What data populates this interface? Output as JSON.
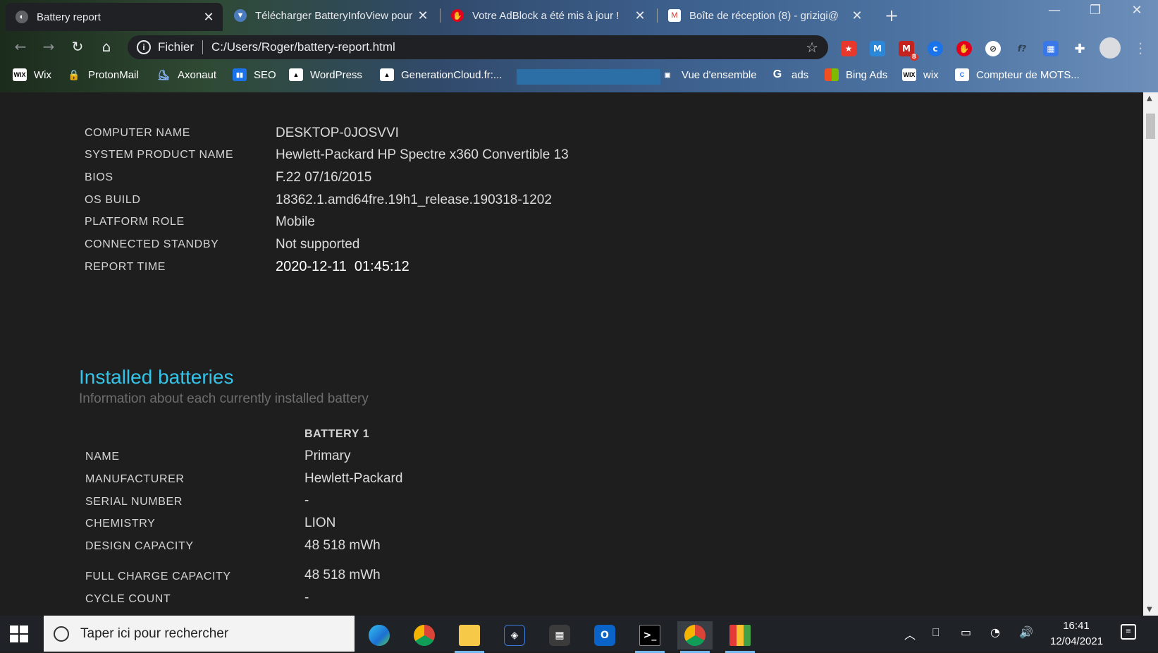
{
  "browser": {
    "tabs": [
      {
        "title": "Battery report",
        "active": true,
        "icon": "battery-report-icon"
      },
      {
        "title": "Télécharger BatteryInfoView pour",
        "active": false,
        "icon": "download-icon"
      },
      {
        "title": "Votre AdBlock a été mis à jour !",
        "active": false,
        "icon": "adblock-icon"
      },
      {
        "title": "Boîte de réception (8) - grizigi@",
        "active": false,
        "icon": "gmail-icon"
      }
    ],
    "address": {
      "scheme_label": "Fichier",
      "url": "C:/Users/Roger/battery-report.html"
    },
    "gmail_badge": "8",
    "bookmarks": [
      {
        "label": "Wix",
        "icon": "wix-icon"
      },
      {
        "label": "ProtonMail",
        "icon": "protonmail-icon"
      },
      {
        "label": "Axonaut",
        "icon": "axonaut-icon"
      },
      {
        "label": "SEO",
        "icon": "chart-icon"
      },
      {
        "label": "WordPress",
        "icon": "wordpress-icon"
      },
      {
        "label": "GenerationCloud.fr:...",
        "icon": "cloud-icon"
      },
      {
        "label": "Vue d'ensemble",
        "icon": "overview-icon"
      },
      {
        "label": "ads",
        "icon": "google-icon"
      },
      {
        "label": "Bing Ads",
        "icon": "microsoft-icon"
      },
      {
        "label": "wix",
        "icon": "wix-icon"
      },
      {
        "label": "Compteur de MOTS...",
        "icon": "counter-icon"
      }
    ]
  },
  "system_info": [
    {
      "label": "COMPUTER NAME",
      "value": "DESKTOP-0JOSVVI"
    },
    {
      "label": "SYSTEM PRODUCT NAME",
      "value": "Hewlett-Packard HP Spectre x360 Convertible 13"
    },
    {
      "label": "BIOS",
      "value": "F.22 07/16/2015"
    },
    {
      "label": "OS BUILD",
      "value": "18362.1.amd64fre.19h1_release.190318-1202"
    },
    {
      "label": "PLATFORM ROLE",
      "value": "Mobile"
    },
    {
      "label": "CONNECTED STANDBY",
      "value": "Not supported"
    },
    {
      "label": "REPORT TIME",
      "value": "2020-12-11  01:45:12"
    }
  ],
  "installed": {
    "heading": "Installed batteries",
    "subheading": "Information about each currently installed battery",
    "column": "BATTERY 1",
    "rows": [
      {
        "label": "NAME",
        "value": "Primary"
      },
      {
        "label": "MANUFACTURER",
        "value": "Hewlett-Packard"
      },
      {
        "label": "SERIAL NUMBER",
        "value": "-"
      },
      {
        "label": "CHEMISTRY",
        "value": "LION"
      },
      {
        "label": "DESIGN CAPACITY",
        "value": "48 518 mWh"
      },
      {
        "label": "FULL CHARGE CAPACITY",
        "value": "48 518 mWh"
      },
      {
        "label": "CYCLE COUNT",
        "value": "-"
      }
    ]
  },
  "taskbar": {
    "search_placeholder": "Taper ici pour rechercher",
    "time": "16:41",
    "date": "12/04/2021"
  },
  "colors": {
    "accent": "#35c3e8",
    "page_bg": "#1e1e1e"
  }
}
